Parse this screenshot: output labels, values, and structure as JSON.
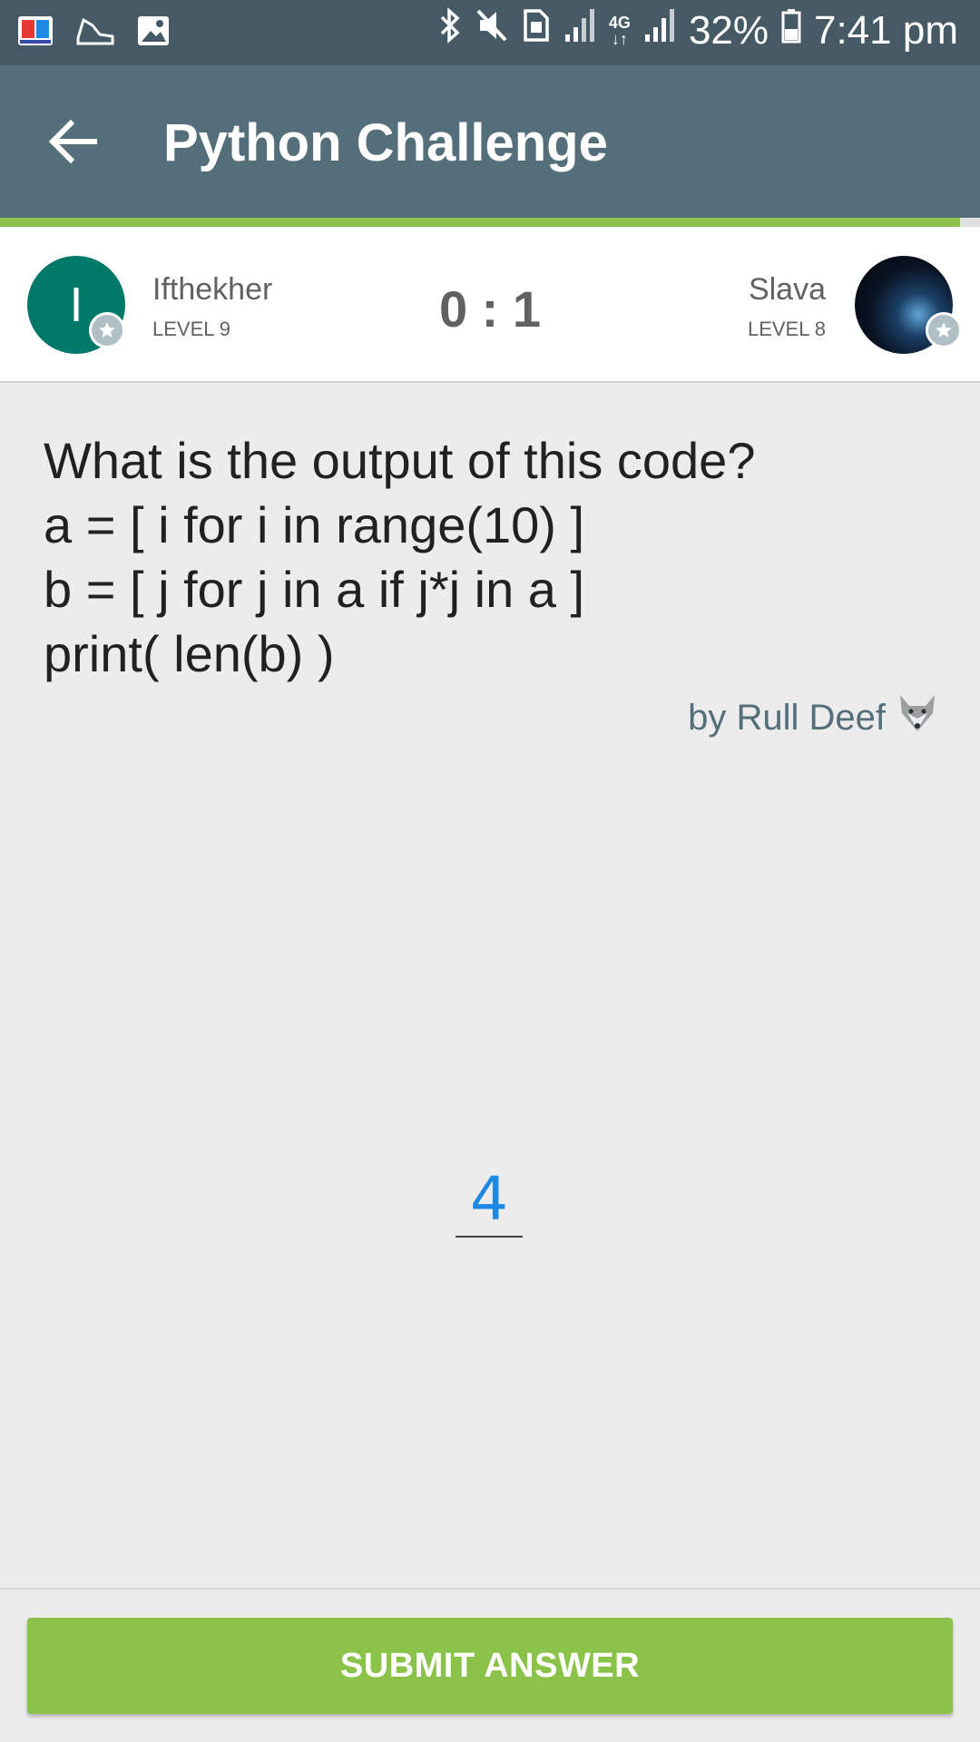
{
  "status_bar": {
    "battery_percent": "32%",
    "time": "7:41 pm",
    "network_type": "4G",
    "icons_left": [
      "app-book-icon",
      "shoe-icon",
      "image-icon"
    ],
    "icons_right": [
      "bluetooth-icon",
      "mute-icon",
      "sim-icon",
      "signal-icon",
      "data-arrows-icon",
      "signal-icon",
      "battery-icon"
    ]
  },
  "app_bar": {
    "title": "Python Challenge",
    "back_icon": "arrow-left-icon"
  },
  "colors": {
    "status_bar": "#455a64",
    "app_bar": "#546e7a",
    "accent_green": "#8bc34a",
    "answer_blue": "#1e88e5",
    "avatar_teal": "#00796b"
  },
  "match": {
    "player_left": {
      "initial": "I",
      "name": "Ifthekher",
      "level": "LEVEL 9"
    },
    "player_right": {
      "name": "Slava",
      "level": "LEVEL 8"
    },
    "score": "0 : 1"
  },
  "question": {
    "lines": [
      "What is the output of this code?",
      "a = [ i for i in range(10) ]",
      "b = [ j for j in a if j*j in a ]",
      "print( len(b) )"
    ],
    "author": "by Rull Deef",
    "author_emoji_icon": "wolf-icon"
  },
  "answer": {
    "value": "4"
  },
  "submit": {
    "label": "SUBMIT ANSWER"
  }
}
